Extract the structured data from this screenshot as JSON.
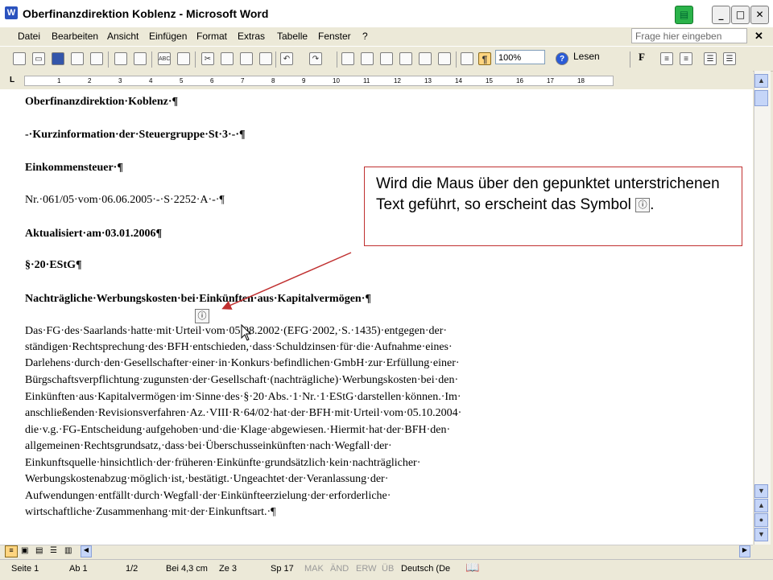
{
  "window": {
    "title": "Oberfinanzdirektion Koblenz - Microsoft Word"
  },
  "menu": [
    "Datei",
    "Bearbeiten",
    "Ansicht",
    "Einfügen",
    "Format",
    "Extras",
    "Tabelle",
    "Fenster",
    "?"
  ],
  "help_placeholder": "Frage hier eingeben",
  "toolbar": {
    "zoom": "100%",
    "read_label": "Lesen",
    "bold_label": "F",
    "pilcrow": "¶"
  },
  "ruler_numbers": [
    "1",
    "2",
    "3",
    "4",
    "5",
    "6",
    "7",
    "8",
    "9",
    "10",
    "11",
    "12",
    "13",
    "14",
    "15",
    "16",
    "17",
    "18"
  ],
  "document": {
    "lines": [
      {
        "text": "Oberfinanzdirektion·Koblenz·¶",
        "bold": true
      },
      {
        "text": "-·Kurzinformation·der·Steuergruppe·St·3·-·¶",
        "bold": true
      },
      {
        "text": "Einkommensteuer·¶",
        "bold": true
      },
      {
        "text": "Nr.·061/05·vom·06.06.2005·-·S·2252·A·-·¶",
        "bold": false
      },
      {
        "text": "Aktualisiert·am·03.01.2006¶",
        "bold": true
      },
      {
        "text": "§·20·EStG¶",
        "bold": true
      },
      {
        "text": "Nachträgliche·Werbungskosten·bei·Einkünften·aus·Kapitalvermögen·¶",
        "bold": true
      },
      {
        "text": "Das·FG·des·Saarlands·hatte·mit·Urteil·vom·05.08.2002·(EFG·2002,·S.·1435)·entgegen·der·",
        "bold": false
      },
      {
        "text": "ständigen·Rechtsprechung·des·BFH·entschieden,·dass·Schuldzinsen·für·die·Aufnahme·eines·",
        "bold": false
      },
      {
        "text": "Darlehens·durch·den·Gesellschafter·einer·in·Konkurs·befindlichen·GmbH·zur·Erfüllung·einer·",
        "bold": false
      },
      {
        "text": "Bürgschaftsverpflichtung·zugunsten·der·Gesellschaft·(nachträgliche)·Werbungskosten·bei·den·",
        "bold": false
      },
      {
        "text": "Einkünften·aus·Kapitalvermögen·im·Sinne·des·§·20·Abs.·1·Nr.·1·EStG·darstellen·können.·Im·",
        "bold": false
      },
      {
        "text": "anschließenden·Revisionsverfahren·Az.·VIII·R·64/02·hat·der·BFH·mit·Urteil·vom·05.10.2004·",
        "bold": false
      },
      {
        "text": "die·v.g.·FG-Entscheidung·aufgehoben·und·die·Klage·abgewiesen.·Hiermit·hat·der·BFH·den·",
        "bold": false
      },
      {
        "text": "allgemeinen·Rechtsgrundsatz,·dass·bei·Überschusseinkünften·nach·Wegfall·der·",
        "bold": false
      },
      {
        "text": "Einkunftsquelle·hinsichtlich·der·früheren·Einkünfte·grundsätzlich·kein·nachträglicher·",
        "bold": false
      },
      {
        "text": "Werbungskostenabzug·möglich·ist,·bestätigt.·Ungeachtet·der·Veranlassung·der·",
        "bold": false
      },
      {
        "text": "Aufwendungen·entfällt·durch·Wegfall·der·Einkünfteerzielung·der·erforderliche·",
        "bold": false
      },
      {
        "text": "wirtschaftliche·Zusammenhang·mit·der·Einkunftsart.·¶",
        "bold": false
      }
    ]
  },
  "callout": {
    "text": "Wird die Maus über den gepunktet unterstrichenen Text geführt, so erscheint das Symbol",
    "end": ".",
    "icon": "smart-tag-icon"
  },
  "status": {
    "page": "Seite 1",
    "section": "Ab 1",
    "pages": "1/2",
    "position": "Bei 4,3 cm",
    "line": "Ze 3",
    "column": "Sp 17",
    "mak": "MAK",
    "aend": "ÄND",
    "erw": "ERW",
    "ueb": "ÜB",
    "language": "Deutsch (De"
  },
  "colors": {
    "callout_border": "#c03030",
    "arrow": "#c03030"
  }
}
